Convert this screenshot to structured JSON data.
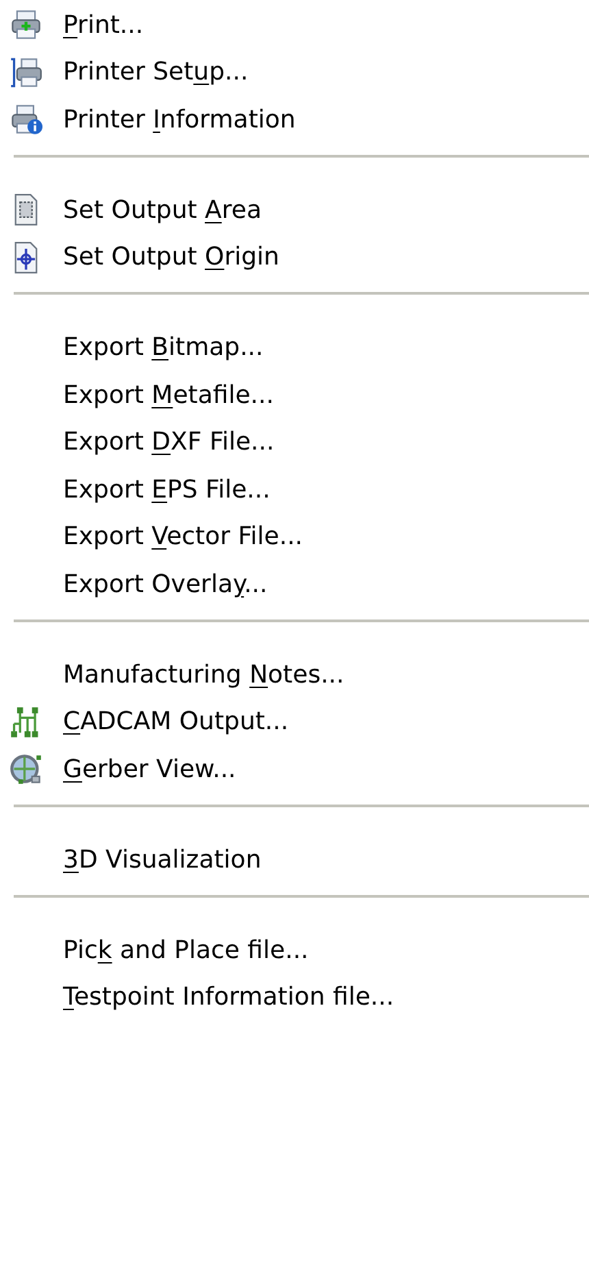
{
  "menu": {
    "items": [
      {
        "kind": "item",
        "key": "P",
        "post": "rint..."
      },
      {
        "kind": "item",
        "pre": "Printer Set",
        "key": "u",
        "post": "p..."
      },
      {
        "kind": "item",
        "pre": "Printer ",
        "key": "I",
        "post": "nformation"
      },
      {
        "kind": "separator"
      },
      {
        "kind": "item",
        "pre": "Set Output ",
        "key": "A",
        "post": "rea"
      },
      {
        "kind": "item",
        "pre": "Set Output ",
        "key": "O",
        "post": "rigin"
      },
      {
        "kind": "separator"
      },
      {
        "kind": "item",
        "pre": "Export ",
        "key": "B",
        "post": "itmap..."
      },
      {
        "kind": "item",
        "pre": "Export ",
        "key": "M",
        "post": "etafile..."
      },
      {
        "kind": "item",
        "pre": "Export ",
        "key": "D",
        "post": "XF File..."
      },
      {
        "kind": "item",
        "pre": "Export ",
        "key": "E",
        "post": "PS File..."
      },
      {
        "kind": "item",
        "pre": "Export ",
        "key": "V",
        "post": "ector File..."
      },
      {
        "kind": "item",
        "pre": "Export Overla",
        "key": "y",
        "post": "..."
      },
      {
        "kind": "separator"
      },
      {
        "kind": "item",
        "pre": "Manufacturing ",
        "key": "N",
        "post": "otes..."
      },
      {
        "kind": "item",
        "key": "C",
        "post": "ADCAM Output..."
      },
      {
        "kind": "item",
        "key": "G",
        "post": "erber View..."
      },
      {
        "kind": "separator"
      },
      {
        "kind": "item",
        "key": "3",
        "post": "D Visualization"
      },
      {
        "kind": "separator"
      },
      {
        "kind": "item",
        "pre": "Pic",
        "key": "k",
        "post": " and Place file..."
      },
      {
        "kind": "item",
        "key": "T",
        "post": "estpoint Information file..."
      }
    ]
  }
}
